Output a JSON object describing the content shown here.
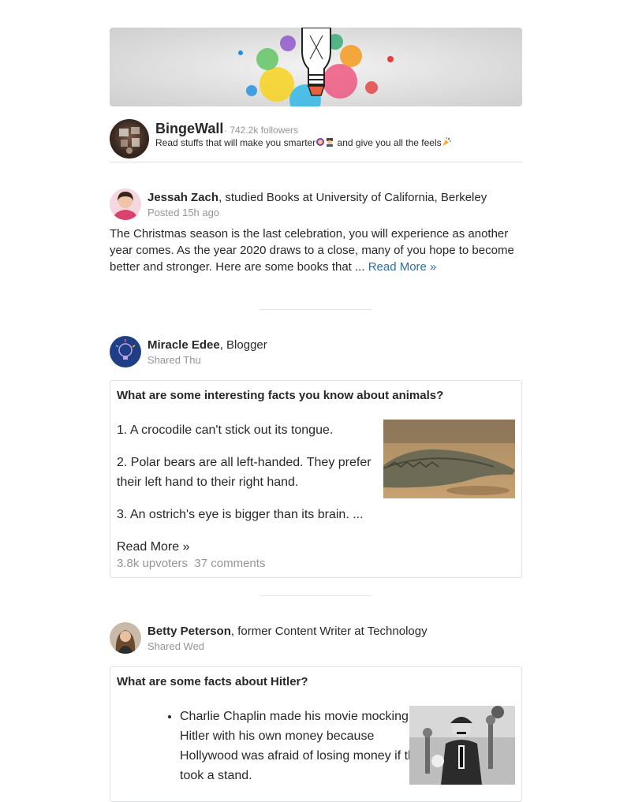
{
  "space": {
    "title": "BingeWall",
    "followers": "· 742.2k followers",
    "desc_part1": "Read stuffs that will make you smarter",
    "desc_part2": " and give you all the feels"
  },
  "posts": [
    {
      "author": "Jessah Zach",
      "credential": ", studied Books at University of California, Berkeley",
      "meta": "Posted 15h ago",
      "text": "The Christmas season is the last celebration, you will experience as another year comes. As the year 2020 draws to a close, many of you hope to become better and stronger. Here are some books that ... ",
      "read_more": "Read More »"
    },
    {
      "author": "Miracle Edee",
      "credential": ", Blogger",
      "meta": "Shared Thu",
      "question": "What are some interesting facts you know about animals?",
      "facts": [
        "1. A crocodile can't stick out its tongue.",
        "2. Polar bears are all left-handed. They prefer their left hand to their right hand.",
        "3. An ostrich's eye is bigger than its brain. ..."
      ],
      "read_more": "Read More »",
      "upvoters": "3.8k upvoters",
      "comments": "37 comments"
    },
    {
      "author": "Betty Peterson",
      "credential": ", former Content Writer at Technology",
      "meta": "Shared Wed",
      "question": "What are some facts about Hitler?",
      "bullet": "Charlie Chaplin made his movie mocking Hitler with his own money because Hollywood was afraid of losing money if they took a stand."
    }
  ]
}
